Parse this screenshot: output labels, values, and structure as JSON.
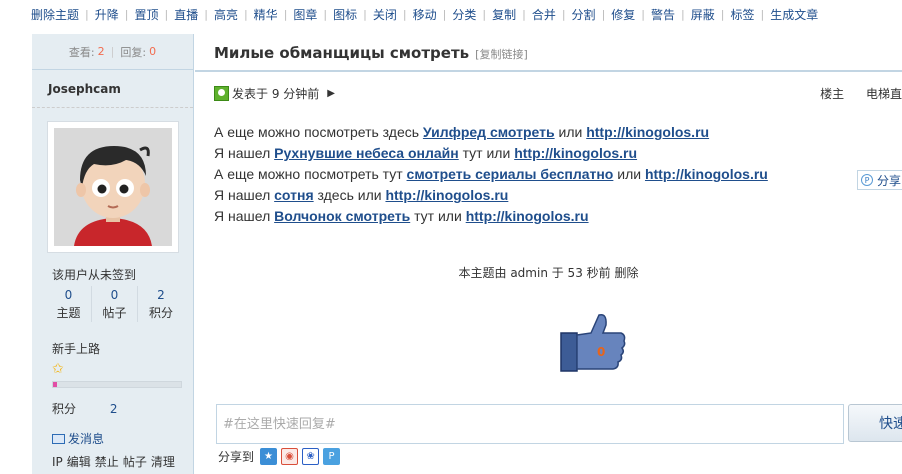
{
  "modbar": {
    "items": [
      "删除主题",
      "升降",
      "置顶",
      "直播",
      "高亮",
      "精华",
      "图章",
      "图标",
      "关闭",
      "移动",
      "分类",
      "复制",
      "合并",
      "分割",
      "修复",
      "警告",
      "屏蔽",
      "标签",
      "生成文章"
    ]
  },
  "stats": {
    "views_label": "查看:",
    "views": "2",
    "replies_label": "回复:",
    "replies": "0"
  },
  "user": {
    "name": "Josephcam",
    "signin": "该用户从未签到",
    "counts": [
      {
        "value": "0",
        "label": "主题"
      },
      {
        "value": "0",
        "label": "帖子"
      },
      {
        "value": "2",
        "label": "积分"
      }
    ],
    "rank": "新手上路",
    "progress_fraction": 0.03,
    "score_label": "积分",
    "score_value": "2",
    "send_message": "发消息",
    "admin_links": [
      "IP",
      "编辑",
      "禁止",
      "帖子",
      "清理"
    ]
  },
  "thread": {
    "title": "Милые обманщицы смотреть",
    "copy_link": "[复制链接]",
    "posted": "发表于 9 分钟前",
    "floor_owner": "楼主",
    "floor_jump": "电梯直"
  },
  "post": {
    "lines": [
      {
        "pre": "А еще можно посмотреть здесь ",
        "link": "Уилфред смотреть",
        "mid": " или ",
        "url": "http://kinogolos.ru "
      },
      {
        "pre": "Я нашел ",
        "link": "Рухнувшие небеса онлайн",
        "mid": " тут или ",
        "url": "http://kinogolos.ru "
      },
      {
        "pre": "А еще можно посмотреть тут ",
        "link": "смотреть сериалы бесплатно",
        "mid": " или ",
        "url": "http://kinogolos.ru "
      },
      {
        "pre": "Я нашел ",
        "link": "сотня",
        "mid": " здесь или ",
        "url": "http://kinogolos.ru "
      },
      {
        "pre": "Я нашел ",
        "link": "Волчонок смотреть",
        "mid": " тут или ",
        "url": "http://kinogolos.ru"
      }
    ]
  },
  "share_float": "分享",
  "moderation_note": "本主题由 admin 于 53 秒前 删除",
  "like_count": "0",
  "reply": {
    "placeholder": "#在这里快速回复#",
    "button": "快速"
  },
  "share_row": {
    "label": "分享到"
  }
}
